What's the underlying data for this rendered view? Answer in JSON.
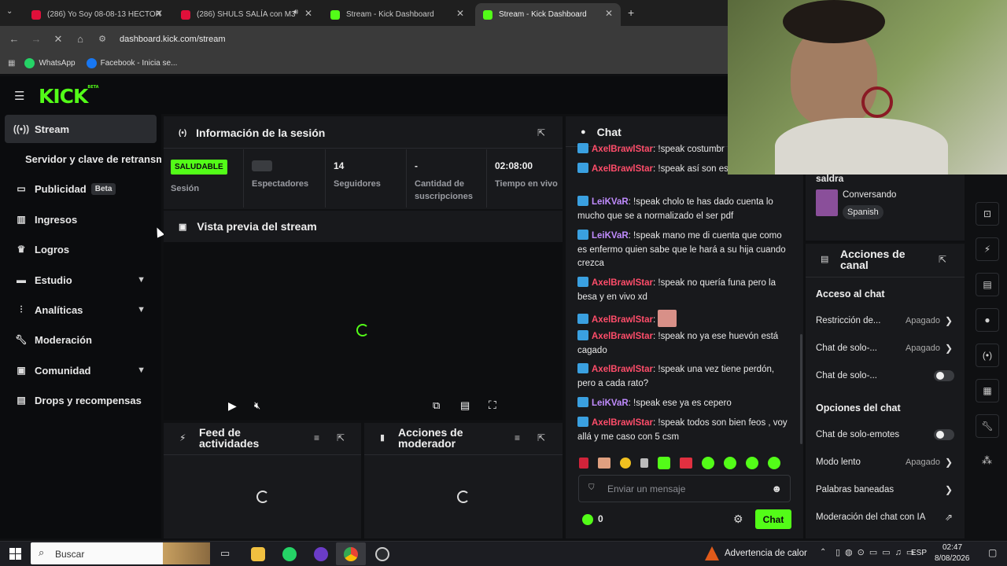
{
  "browser": {
    "tabs": [
      {
        "label": "(286) Yo Soy 08-08-13 HECTOR",
        "fav_color": "#e0103a"
      },
      {
        "label": "(286) SHULS SALÍA con M3",
        "fav_color": "#e0103a"
      },
      {
        "label": "Stream - Kick Dashboard",
        "fav_color": "#53fc18"
      },
      {
        "label": "Stream - Kick Dashboard",
        "fav_color": "#53fc18"
      }
    ],
    "new_tab": "+",
    "url": "dashboard.kick.com/stream",
    "bookmarks": [
      "WhatsApp",
      "Facebook - Inicia se..."
    ]
  },
  "brand": {
    "logo": "KICK",
    "logo_badge": "BETA",
    "accent": "#53fc18"
  },
  "sidebar": {
    "items": [
      {
        "label": "Stream",
        "icon": "broadcast-icon"
      },
      {
        "label": "Servidor y clave de retransmisión",
        "icon": ""
      },
      {
        "label": "Publicidad",
        "icon": "monitor-icon",
        "badge": "Beta"
      },
      {
        "label": "Ingresos",
        "icon": "chart-icon"
      },
      {
        "label": "Logros",
        "icon": "trophy-icon"
      },
      {
        "label": "Estudio",
        "icon": "studio-icon"
      },
      {
        "label": "Analíticas",
        "icon": "analytics-icon"
      },
      {
        "label": "Moderación",
        "icon": "wrench-icon"
      },
      {
        "label": "Comunidad",
        "icon": "community-icon"
      },
      {
        "label": "Drops y recompensas",
        "icon": "drops-icon"
      }
    ]
  },
  "session": {
    "title": "Información de la sesión",
    "status_badge": "SALUDABLE",
    "status_label": "Sesión",
    "stats": [
      {
        "value": "",
        "label": "Espectadores"
      },
      {
        "value": "14",
        "label": "Seguidores"
      },
      {
        "value": "-",
        "label": "Cantidad de suscripciones"
      },
      {
        "value": "02:08:00",
        "label": "Tiempo en vivo"
      }
    ]
  },
  "preview": {
    "title": "Vista previa del stream"
  },
  "activity": {
    "title": "Feed de actividades"
  },
  "mod_actions": {
    "title": "Acciones de moderador"
  },
  "chat": {
    "title": "Chat",
    "messages": [
      {
        "user": "AxelBrawlStar",
        "color": "#ff4d6a",
        "text": ": !speak costumbr"
      },
      {
        "user": "AxelBrawlStar",
        "color": "#ff4d6a",
        "text": ": !speak así son es conche"
      },
      {
        "user": "LeiKVaR",
        "color": "#c18cff",
        "text": ": !speak cholo te has dado cuenta lo mucho que se a normalizado el ser pdf"
      },
      {
        "user": "LeiKVaR",
        "color": "#c18cff",
        "text": ": !speak mano me di cuenta que como es enfermo quien sabe que le hará a su hija cuando crezca"
      },
      {
        "user": "AxelBrawlStar",
        "color": "#ff4d6a",
        "text": ": !speak no quería funa pero la besa y en vivo xd"
      },
      {
        "user": "AxelBrawlStar",
        "color": "#ff4d6a",
        "text": ":"
      },
      {
        "user": "AxelBrawlStar",
        "color": "#ff4d6a",
        "text": ": !speak no ya ese huevón está cagado"
      },
      {
        "user": "AxelBrawlStar",
        "color": "#ff4d6a",
        "text": ": !speak una vez tiene perdón, pero a cada rato?"
      },
      {
        "user": "LeiKVaR",
        "color": "#c18cff",
        "text": ": !speak ese ya es cepero"
      },
      {
        "user": "AxelBrawlStar",
        "color": "#ff4d6a",
        "text": ": !speak todos son bien feos , voy allá y me caso con 5 csm"
      }
    ],
    "input_placeholder": "Enviar un mensaje",
    "points": "0",
    "send_label": "Chat"
  },
  "stream_info": {
    "name_partial": "saldra",
    "category": "Conversando",
    "language": "Spanish"
  },
  "channel_actions": {
    "title": "Acciones de canal",
    "access_title": "Acceso al chat",
    "access_rows": [
      {
        "label": "Restricción de...",
        "value": "Apagado"
      },
      {
        "label": "Chat de solo-...",
        "value": "Apagado"
      },
      {
        "label": "Chat de solo-...",
        "value": ""
      }
    ],
    "options_title": "Opciones del chat",
    "option_rows": [
      {
        "label": "Chat de solo-emotes",
        "value": ""
      },
      {
        "label": "Modo lento",
        "value": "Apagado"
      },
      {
        "label": "Palabras baneadas",
        "value": ""
      },
      {
        "label": "Moderación del chat con IA",
        "value": ""
      }
    ]
  },
  "taskbar": {
    "search": "Buscar",
    "weather": "Advertencia de calor",
    "lang": "ESP",
    "time": "02:47",
    "date": "8/08/2026"
  }
}
